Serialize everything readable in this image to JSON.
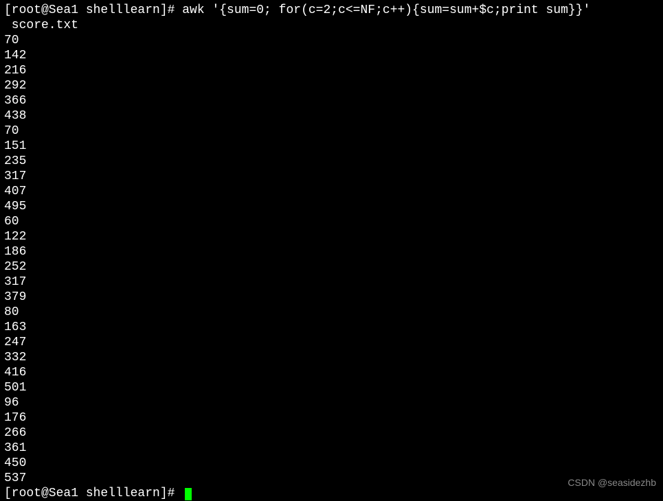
{
  "terminal": {
    "command_line1": "[root@Sea1 shelllearn]# awk '{sum=0; for(c=2;c<=NF;c++){sum=sum+$c;print sum}}'",
    "command_line2": " score.txt",
    "output": [
      "70",
      "142",
      "216",
      "292",
      "366",
      "438",
      "70",
      "151",
      "235",
      "317",
      "407",
      "495",
      "60",
      "122",
      "186",
      "252",
      "317",
      "379",
      "80",
      "163",
      "247",
      "332",
      "416",
      "501",
      "96",
      "176",
      "266",
      "361",
      "450",
      "537"
    ],
    "prompt": "[root@Sea1 shelllearn]# "
  },
  "watermark": "CSDN @seasidezhb"
}
